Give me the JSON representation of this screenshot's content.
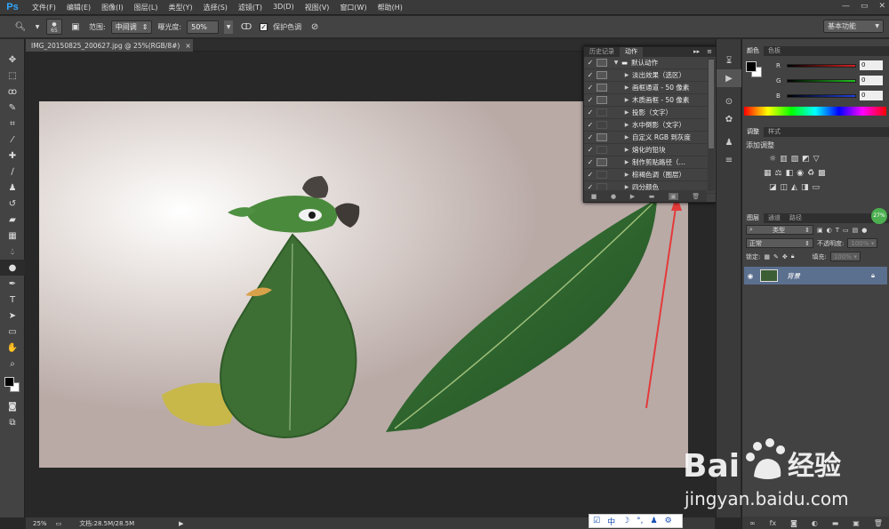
{
  "app": {
    "logo": "Ps"
  },
  "menubar": {
    "items": [
      "文件(F)",
      "编辑(E)",
      "图像(I)",
      "图层(L)",
      "类型(Y)",
      "选择(S)",
      "滤镜(T)",
      "3D(D)",
      "视图(V)",
      "窗口(W)",
      "帮助(H)"
    ]
  },
  "options": {
    "brush_size": "65",
    "range_label": "范围:",
    "range_value": "中间调",
    "exposure_label": "曝光度:",
    "exposure_value": "50%",
    "protect_tones_label": "保护色调",
    "workspace": "基本功能"
  },
  "document": {
    "tab_title": "IMG_20150825_200627.jpg @ 25%(RGB/8#)",
    "zoom": "25%",
    "doc_info": "文档:28.5M/28.5M"
  },
  "actions_panel": {
    "tabs": [
      "历史记录",
      "动作"
    ],
    "active_tab": "动作",
    "set_name": "默认动作",
    "items": [
      {
        "label": "淡出效果（选区）",
        "dialog": true
      },
      {
        "label": "画框通道 - 50 像素",
        "dialog": true
      },
      {
        "label": "木质画框 - 50 像素",
        "dialog": true
      },
      {
        "label": "投影（文字）",
        "dialog": false
      },
      {
        "label": "水中倒影（文字）",
        "dialog": false
      },
      {
        "label": "自定义 RGB 到灰度",
        "dialog": true
      },
      {
        "label": "熔化的铅块",
        "dialog": false
      },
      {
        "label": "制作剪贴路径（…",
        "dialog": true
      },
      {
        "label": "棕褐色调（图层）",
        "dialog": false
      },
      {
        "label": "四分颜色",
        "dialog": false
      }
    ]
  },
  "color_panel": {
    "tabs": [
      "颜色",
      "色板"
    ],
    "channels": [
      {
        "name": "R",
        "value": "0",
        "color": "#d42020"
      },
      {
        "name": "G",
        "value": "0",
        "color": "#20c020"
      },
      {
        "name": "B",
        "value": "0",
        "color": "#2040e0"
      }
    ]
  },
  "adjust_panel": {
    "tabs": [
      "调整",
      "样式"
    ],
    "title": "添加调整"
  },
  "layers_panel": {
    "tabs": [
      "图层",
      "通道",
      "路径"
    ],
    "filter_label": "类型",
    "blend_mode": "正常",
    "opacity_label": "不透明度:",
    "opacity_value": "100%",
    "lock_label": "锁定:",
    "fill_label": "填充:",
    "fill_value": "100%",
    "layers": [
      {
        "name": "背景"
      }
    ],
    "badge": "27%"
  },
  "ime": {
    "mode": "中"
  },
  "watermark": {
    "brand_a": "Bai",
    "brand_b": "经验",
    "url": "jingyan.baidu.com"
  }
}
